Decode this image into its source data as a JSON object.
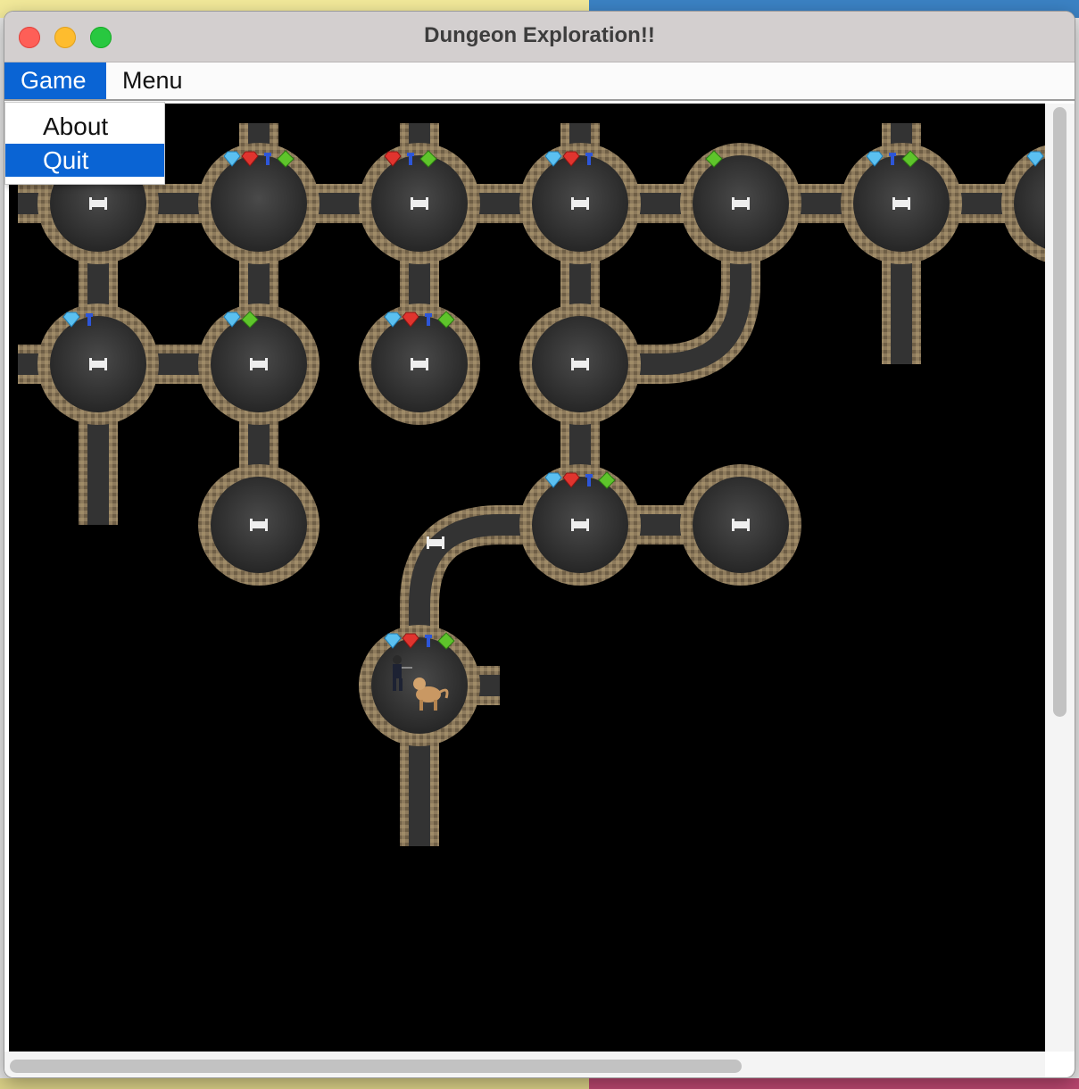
{
  "window": {
    "title": "Dungeon Exploration!!"
  },
  "menubar": {
    "items": [
      {
        "label": "Game",
        "active": true
      },
      {
        "label": "Menu",
        "active": false
      }
    ]
  },
  "game_menu": {
    "items": [
      {
        "label": "About",
        "highlighted": false
      },
      {
        "label": "Quit",
        "highlighted": true
      }
    ]
  },
  "map": {
    "rooms": [
      {
        "col": 0,
        "row": 0,
        "gems": [],
        "exit": true
      },
      {
        "col": 1,
        "row": 0,
        "gems": [
          "diamond",
          "ruby",
          "key",
          "emerald"
        ],
        "exit": false
      },
      {
        "col": 2,
        "row": 0,
        "gems": [
          "ruby",
          "key",
          "emerald"
        ],
        "exit": true
      },
      {
        "col": 3,
        "row": 0,
        "gems": [
          "diamond",
          "ruby",
          "key"
        ],
        "exit": true
      },
      {
        "col": 4,
        "row": 0,
        "gems": [
          "emerald"
        ],
        "exit": true
      },
      {
        "col": 5,
        "row": 0,
        "gems": [
          "diamond",
          "key",
          "emerald"
        ],
        "exit": true
      },
      {
        "col": 6,
        "row": 0,
        "gems": [
          "diamond"
        ],
        "exit": false
      },
      {
        "col": 0,
        "row": 1,
        "gems": [
          "diamond",
          "key"
        ],
        "exit": true
      },
      {
        "col": 1,
        "row": 1,
        "gems": [
          "diamond",
          "emerald"
        ],
        "exit": true
      },
      {
        "col": 2,
        "row": 1,
        "gems": [
          "diamond",
          "ruby",
          "key",
          "emerald"
        ],
        "exit": true
      },
      {
        "col": 3,
        "row": 1,
        "gems": [],
        "exit": true
      },
      {
        "col": 1,
        "row": 2,
        "gems": [],
        "exit": true
      },
      {
        "col": 3,
        "row": 2,
        "gems": [
          "diamond",
          "ruby",
          "key",
          "emerald"
        ],
        "exit": true
      },
      {
        "col": 4,
        "row": 2,
        "gems": [],
        "exit": true
      },
      {
        "col": 2,
        "row": 3,
        "gems": [
          "diamond",
          "ruby",
          "key",
          "emerald"
        ],
        "exit": false,
        "player": true,
        "monster": true
      }
    ],
    "corridors": [
      [
        "0,0",
        "1,0"
      ],
      [
        "1,0",
        "2,0"
      ],
      [
        "2,0",
        "3,0"
      ],
      [
        "3,0",
        "4,0"
      ],
      [
        "4,0",
        "5,0"
      ],
      [
        "5,0",
        "6,0"
      ],
      [
        "0,1",
        "1,1"
      ],
      [
        "0,0",
        "0,1"
      ],
      [
        "1,0",
        "1,1"
      ],
      [
        "2,0",
        "2,1"
      ],
      [
        "3,0",
        "3,1"
      ],
      [
        "1,1",
        "1,2"
      ],
      [
        "3,1",
        "3,2"
      ],
      [
        "3,2",
        "4,2"
      ],
      [
        "2,3",
        "2,4"
      ],
      [
        "0,1",
        "0,2"
      ],
      [
        "5,0",
        "5,1"
      ]
    ],
    "curves": [
      {
        "from": "4,0",
        "to": "3,1",
        "kind": "curve-bottom-left"
      },
      {
        "from": "3,2",
        "to": "2,3",
        "kind": "curve-left-down",
        "marker": true
      }
    ],
    "colors": {
      "floor": "#3b3b3b",
      "wall": "#8d7a5c",
      "background": "#000000"
    }
  }
}
